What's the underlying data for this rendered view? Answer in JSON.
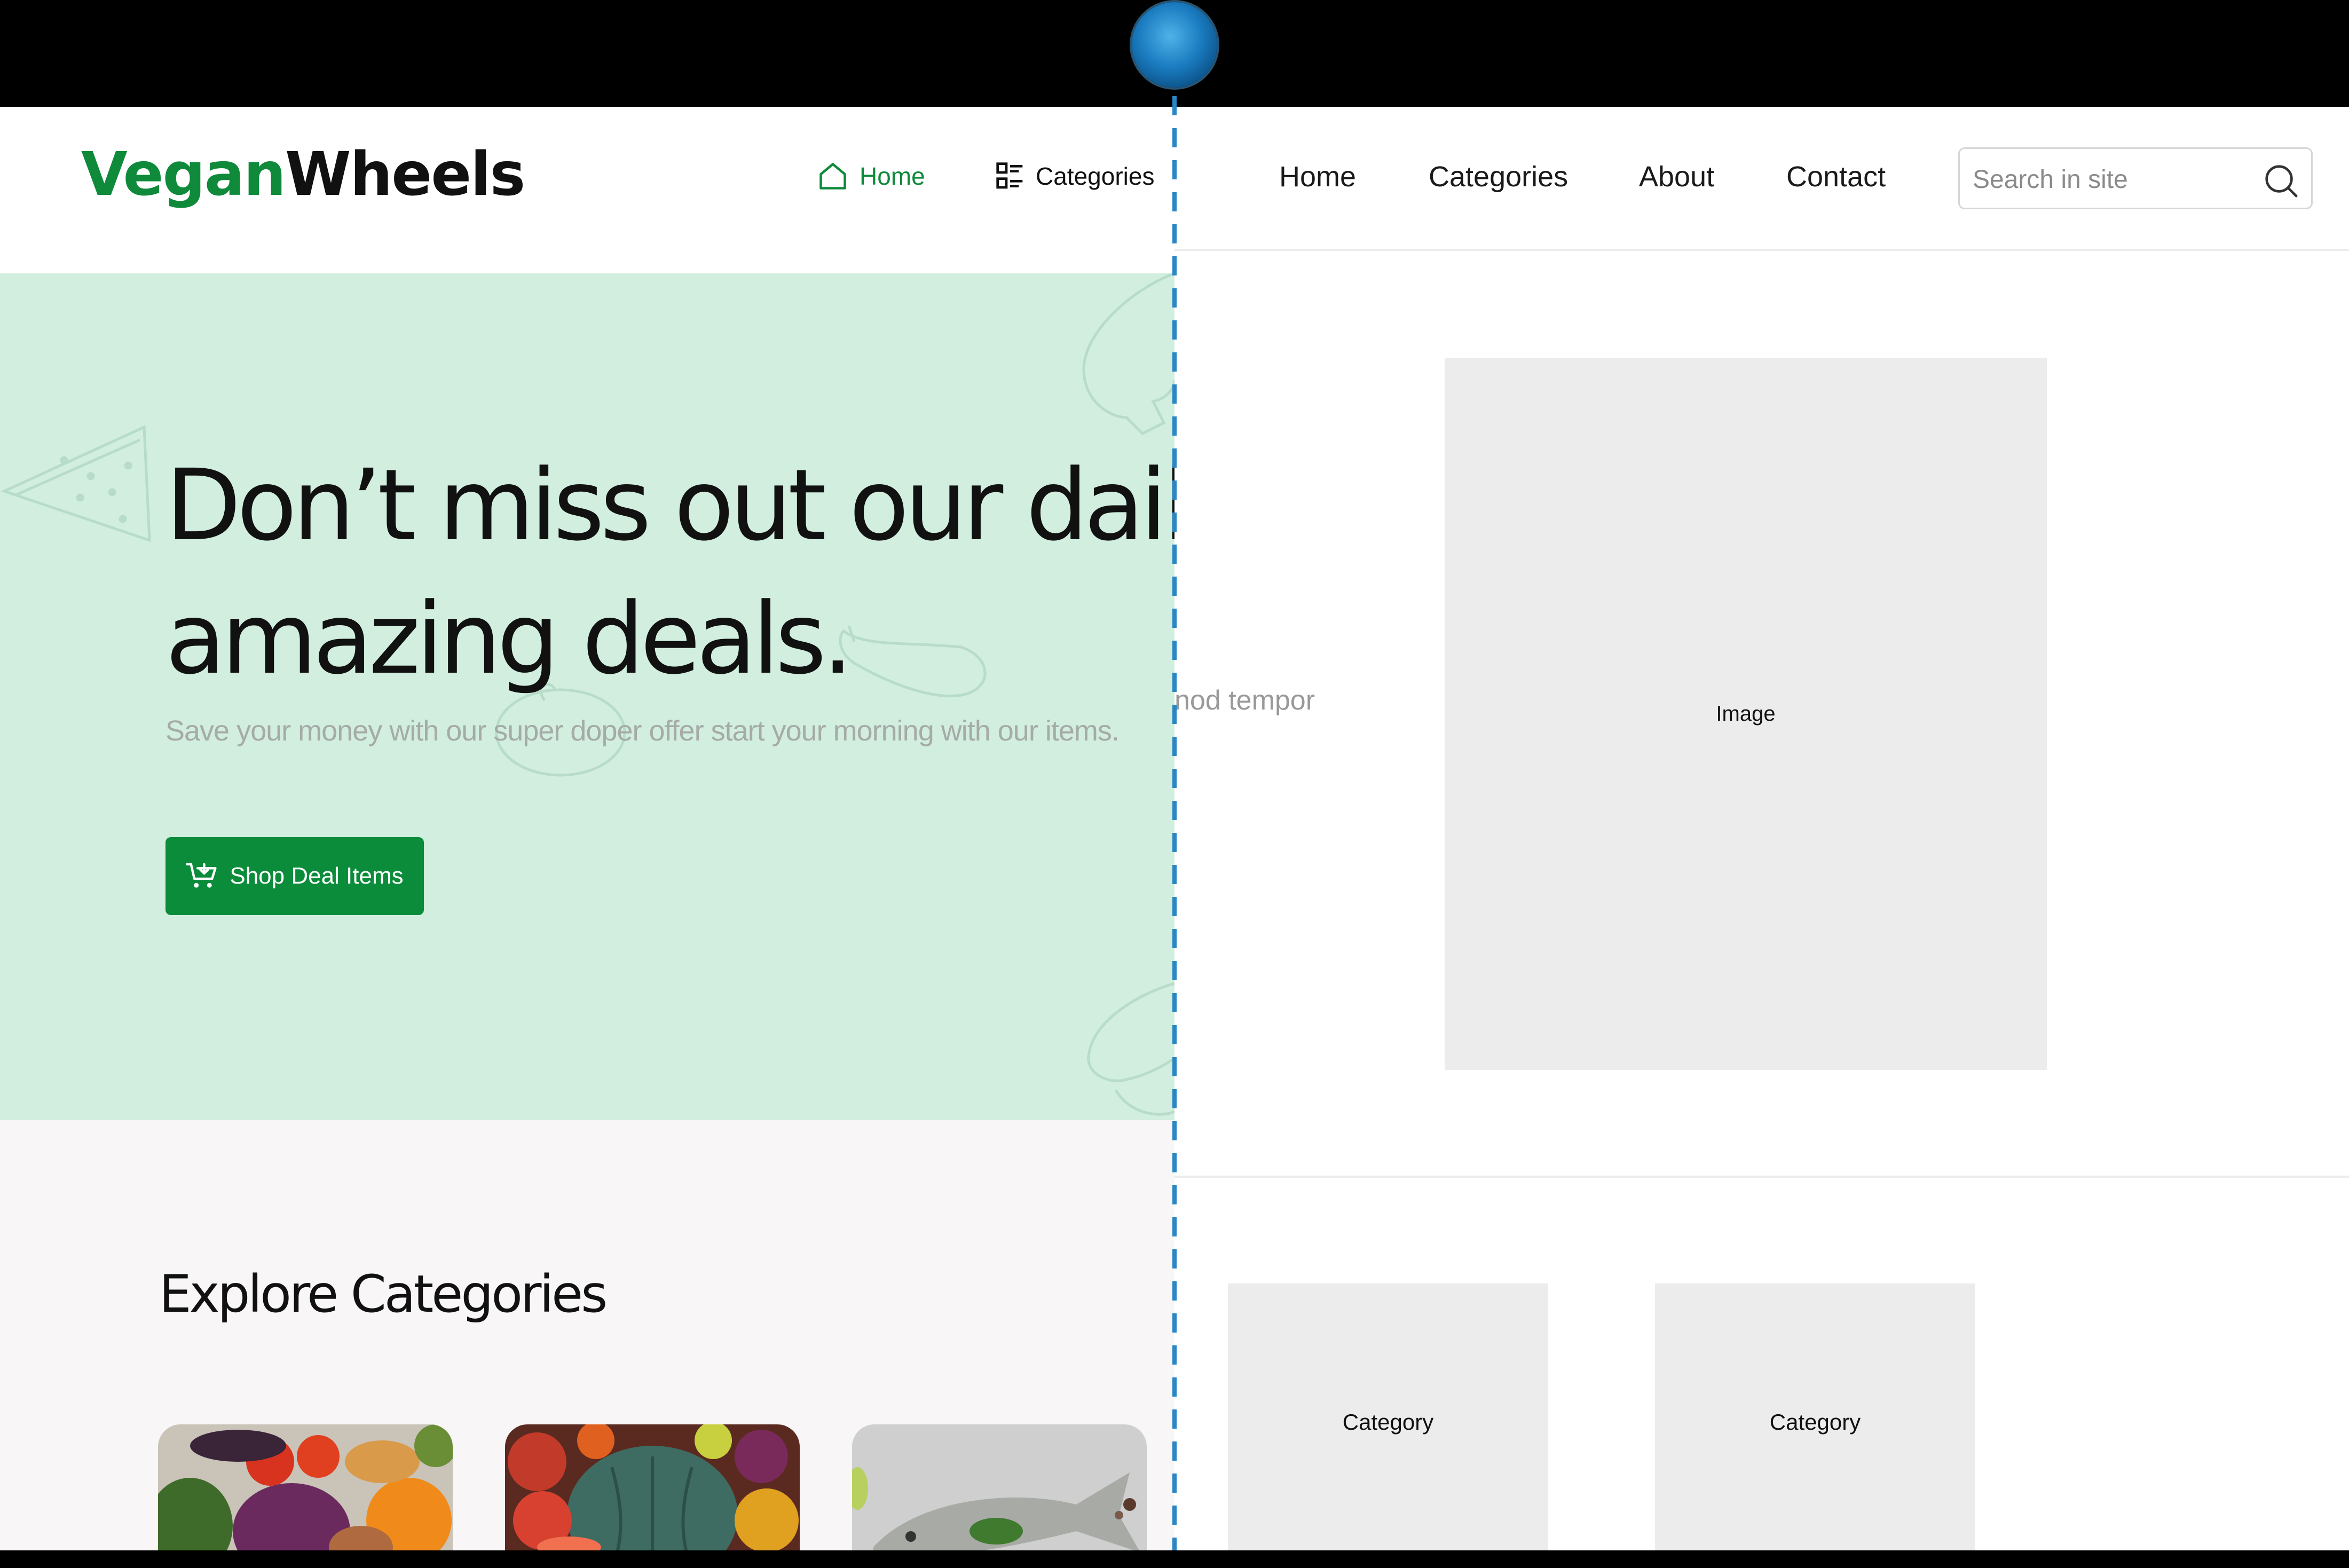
{
  "right": {
    "nav": [
      "Home",
      "Categories",
      "About",
      "Contact"
    ],
    "search_placeholder": "Search in site",
    "image_label": "Image",
    "partial_text": "nod tempor",
    "categories": [
      "Category",
      "Category"
    ]
  },
  "left": {
    "logo": {
      "part1": "Vegan",
      "part2": "Wheels"
    },
    "nav": {
      "home": "Home",
      "categories": "Categories"
    },
    "hero": {
      "line1": "Don’t miss out our daily",
      "line2": "amazing deals.",
      "subtitle": "Save your money with our super doper offer start your morning with our items.",
      "button": "Shop Deal Items"
    },
    "explore_title": "Explore Categories"
  },
  "colors": {
    "brand_green": "#0e8a3a",
    "hero_bg": "#d1eedf",
    "placeholder_gray": "#ececec",
    "divider_blue": "#2a86c4"
  }
}
